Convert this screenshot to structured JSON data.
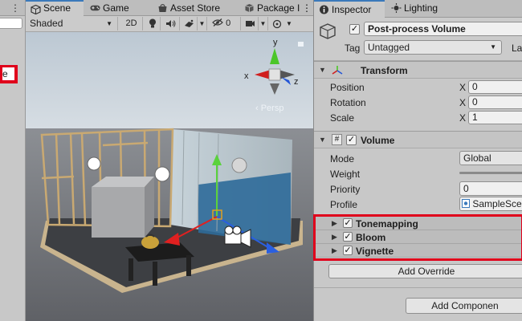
{
  "hierarchy": {
    "selected_item_fragment": "e"
  },
  "scene": {
    "tabs": [
      {
        "label": "Scene",
        "icon": "scene-icon"
      },
      {
        "label": "Game",
        "icon": "game-controller-icon"
      },
      {
        "label": "Asset Store",
        "icon": "store-icon"
      },
      {
        "label": "Package I",
        "icon": "package-icon"
      }
    ],
    "shading_mode": "Shaded",
    "mode_2d": "2D",
    "hidden_count": "0",
    "gizmo": {
      "x": "x",
      "y": "y",
      "z": "z",
      "projection": "‹ Persp"
    }
  },
  "inspector": {
    "tabs": [
      {
        "label": "Inspector",
        "icon": "info-icon"
      },
      {
        "label": "Lighting",
        "icon": "lighting-icon"
      }
    ],
    "object_name": "Post-process Volume",
    "tag_label": "Tag",
    "tag_value": "Untagged",
    "layer_label": "La",
    "transform": {
      "title": "Transform",
      "rows": [
        {
          "label": "Position",
          "axis": "X",
          "value": "0"
        },
        {
          "label": "Rotation",
          "axis": "X",
          "value": "0"
        },
        {
          "label": "Scale",
          "axis": "X",
          "value": "1"
        }
      ]
    },
    "volume": {
      "title": "Volume",
      "mode_label": "Mode",
      "mode_value": "Global",
      "weight_label": "Weight",
      "priority_label": "Priority",
      "priority_value": "0",
      "profile_label": "Profile",
      "profile_value": "SampleScen",
      "overrides": [
        "Tonemapping",
        "Bloom",
        "Vignette"
      ],
      "add_override_label": "Add Override"
    },
    "add_component_label": "Add Componen"
  },
  "colors": {
    "highlight_red": "#e0001b",
    "accent_blue": "#3a79bb"
  }
}
